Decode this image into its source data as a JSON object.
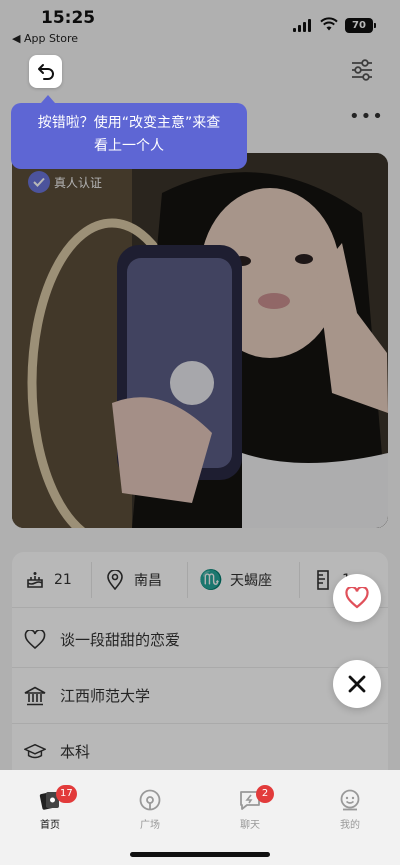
{
  "status_bar": {
    "time": "15:25",
    "back_to_app": "◀ App Store",
    "battery": "70"
  },
  "tooltip": {
    "line1": "按错啦？使用“改变主意”来查",
    "line2": "看上一个人"
  },
  "photo": {
    "verify_label": "真人认证"
  },
  "profile": {
    "age": "21",
    "city": "南昌",
    "zodiac": "天蝎座",
    "height_partial": "1",
    "relationship_goal": "谈一段甜甜的恋爱",
    "school": "江西师范大学",
    "education": "本科"
  },
  "tabs": [
    {
      "label": "首页",
      "badge": "17",
      "icon": "home-cards-icon",
      "active": true
    },
    {
      "label": "广场",
      "badge": "",
      "icon": "plaza-icon",
      "active": false
    },
    {
      "label": "聊天",
      "badge": "2",
      "icon": "chat-icon",
      "active": false
    },
    {
      "label": "我的",
      "badge": "",
      "icon": "profile-icon",
      "active": false
    }
  ],
  "colors": {
    "accent": "#5e66d4",
    "badge": "#e23b3b",
    "like": "#e0505a"
  }
}
